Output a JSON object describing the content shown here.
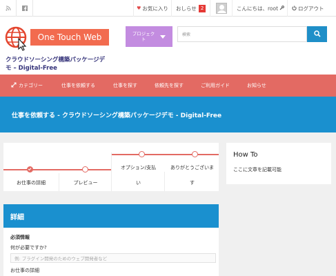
{
  "topbar": {
    "favorites": "お気に入り",
    "notices": "おしらせ",
    "notice_count": "2",
    "greeting": "こんにちは、root",
    "logout": "ログアウト"
  },
  "header": {
    "logo_text": "One Touch Web",
    "site_title": "クラウドソーシング構築パッケージデモ – Digital-Free",
    "project_button": "プロジェクト",
    "search_placeholder": "検索"
  },
  "nav": {
    "items": [
      "カテゴリー",
      "仕事を依頼する",
      "仕事を探す",
      "依頼先を探す",
      "ご利用ガイド",
      "お知らせ"
    ]
  },
  "page_title": "仕事を依頼する - クラウドソーシング構築パッケージデモ - Digital-Free",
  "steps": [
    {
      "label": "お仕事の詳細",
      "done": true
    },
    {
      "label": "プレビュー",
      "done": false
    },
    {
      "label_top": "オプション/支払",
      "label_bottom": "い",
      "done": false
    },
    {
      "label_top": "ありがとうございま",
      "label_bottom": "す",
      "done": false
    }
  ],
  "details": {
    "heading": "詳細",
    "required": "必須情報",
    "question": "何が必要ですか?",
    "placeholder": "例: プラグイン開発のためのウェブ開発者など",
    "job_details_label": "お仕事の詳細"
  },
  "sidebar": {
    "title": "How To",
    "text": "ここに文章を記載可能"
  },
  "colors": {
    "accent_red": "#e36a63",
    "primary_blue": "#1a90cf",
    "logo_orange": "#f26b4f",
    "project_purple": "#c38ce0",
    "badge_red": "#e53935"
  }
}
